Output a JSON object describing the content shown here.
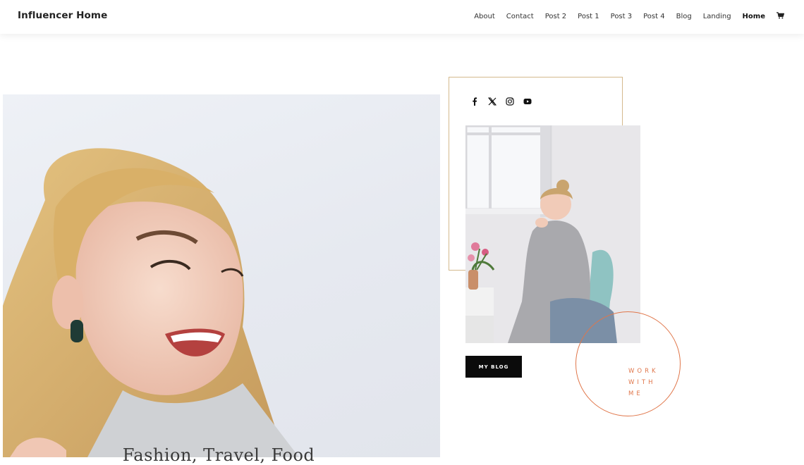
{
  "header": {
    "logo": "Influencer Home",
    "nav": [
      {
        "label": "About"
      },
      {
        "label": "Contact"
      },
      {
        "label": "Post 2"
      },
      {
        "label": "Post 1"
      },
      {
        "label": "Post 3"
      },
      {
        "label": "Post 4"
      },
      {
        "label": "Blog"
      },
      {
        "label": "Landing"
      },
      {
        "label": "Home",
        "active": true
      }
    ],
    "cart_icon": "cart-icon"
  },
  "hero": {
    "caption": "Fashion, Travel, Food",
    "image": "smiling-blonde-woman-portrait"
  },
  "sidebar": {
    "social_icons": [
      "facebook-icon",
      "x-icon",
      "instagram-icon",
      "youtube-icon"
    ],
    "photo": "woman-in-grey-sweater-seated-by-window",
    "blog_button": "MY BLOG",
    "work_with_me": "WORK WITH ME"
  },
  "colors": {
    "accent": "#e0764a",
    "frame": "#d4b98d",
    "button_bg": "#0b0b0b"
  }
}
